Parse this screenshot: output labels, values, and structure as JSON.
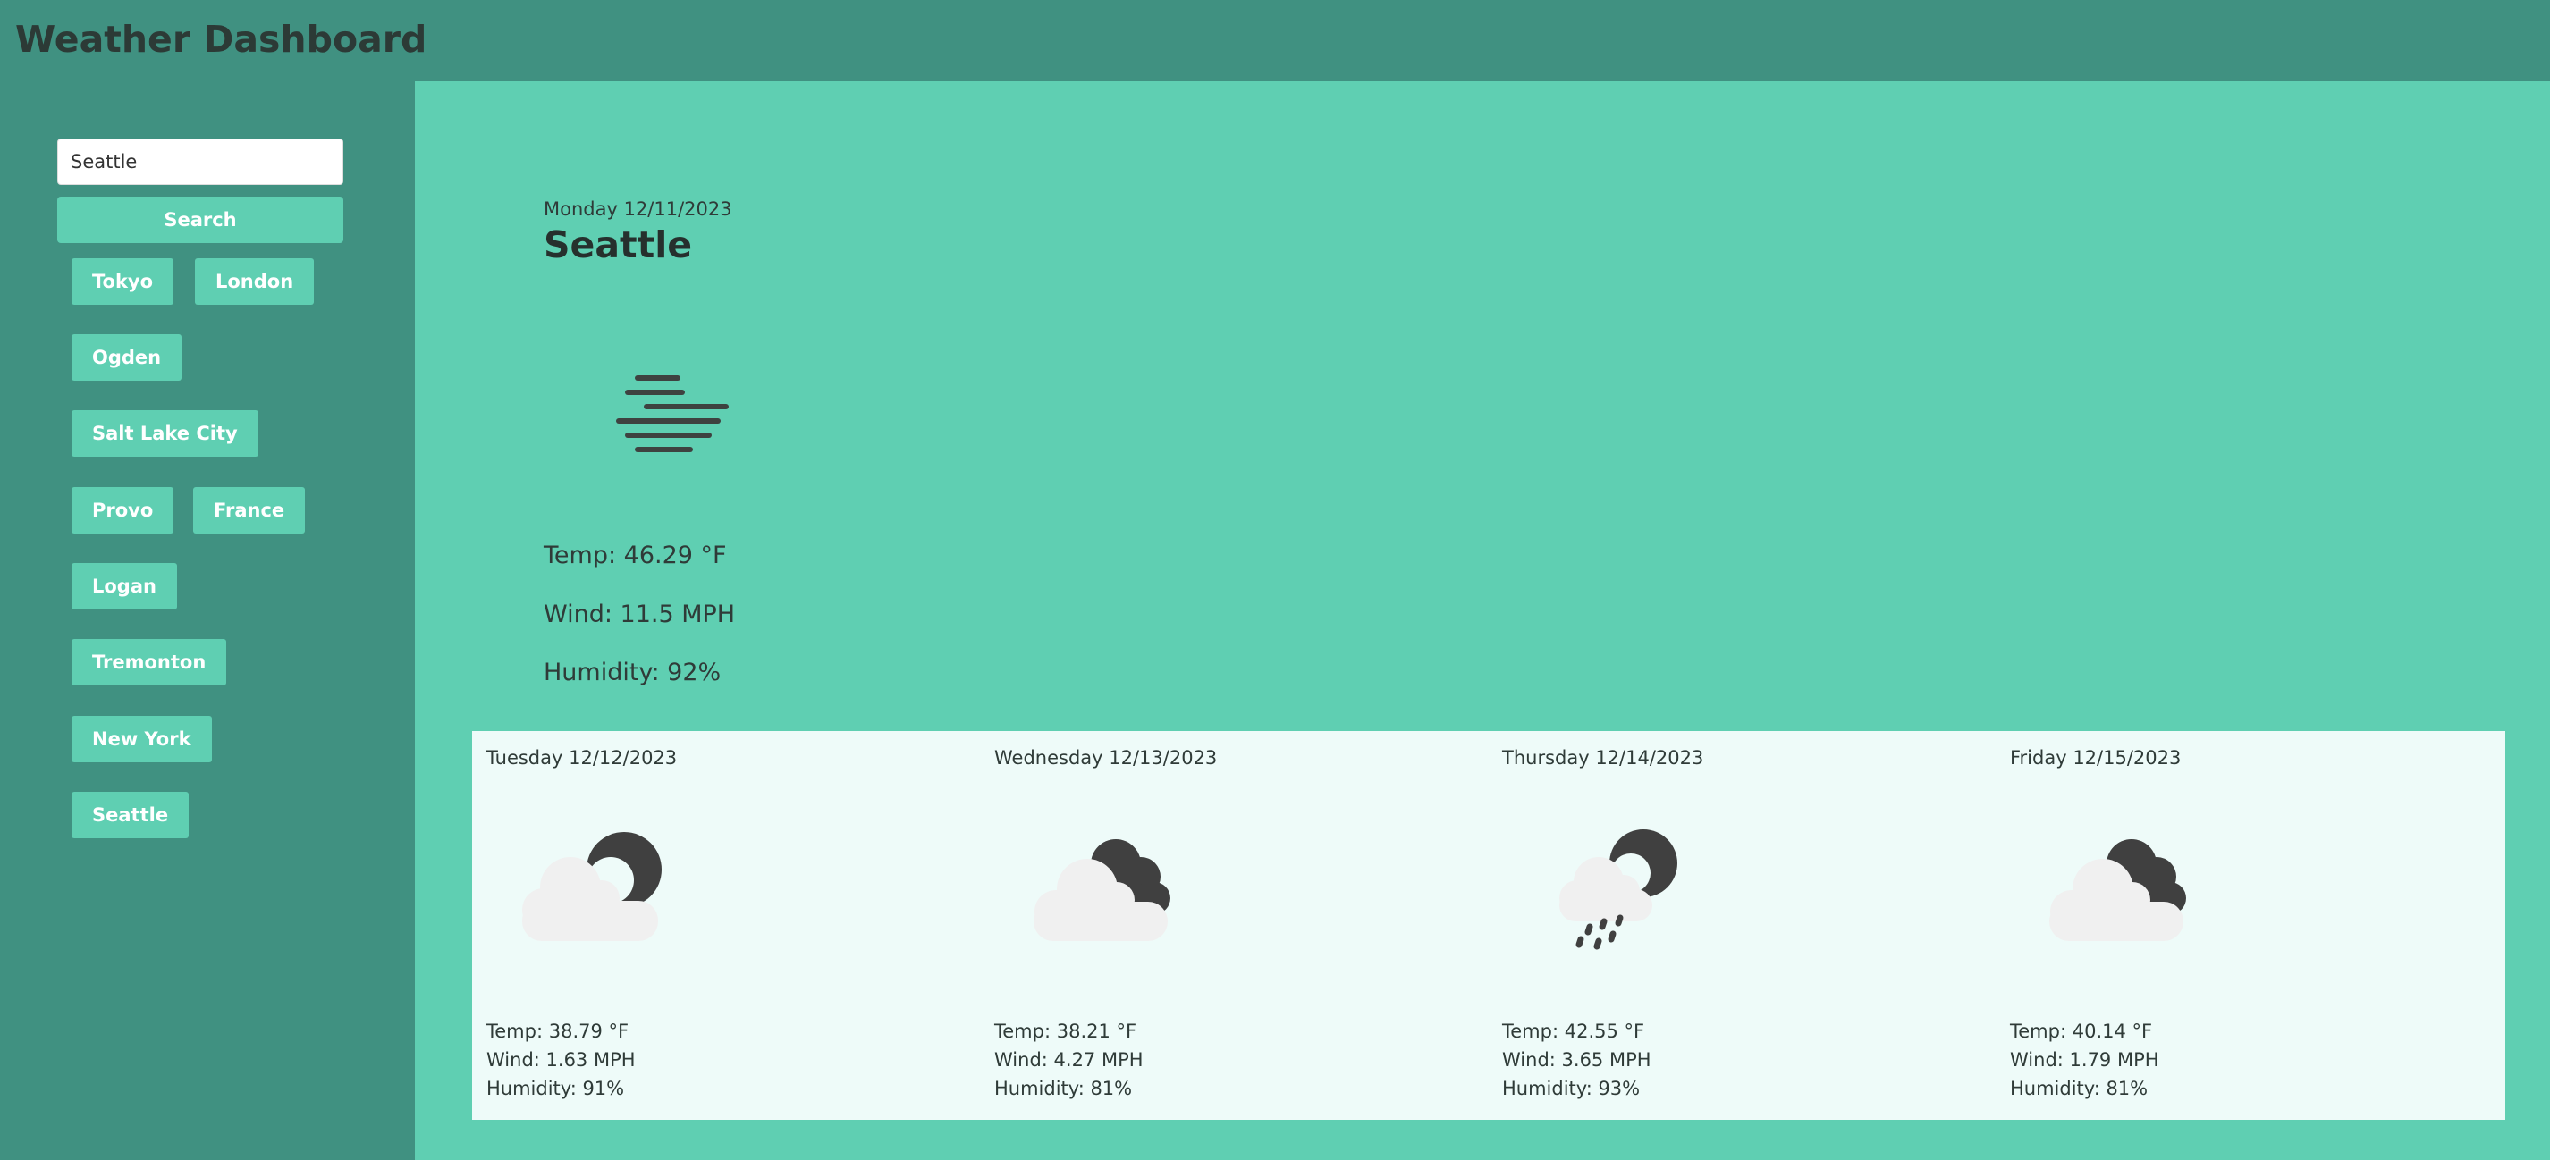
{
  "header": {
    "title": "Weather Dashboard"
  },
  "sidebar": {
    "search": {
      "value": "Seattle",
      "button_label": "Search"
    },
    "history": [
      "Tokyo",
      "London",
      "Ogden",
      "Salt Lake City",
      "Provo",
      "France",
      "Logan",
      "Tremonton",
      "New York",
      "Seattle"
    ]
  },
  "current": {
    "date": "Monday 12/11/2023",
    "city": "Seattle",
    "icon": "fog-icon",
    "temp": "Temp: 46.29 °F",
    "wind": "Wind: 11.5 MPH",
    "humidity": "Humidity: 92%"
  },
  "forecast": [
    {
      "date": "Tuesday 12/12/2023",
      "icon": "partly-cloudy-night-icon",
      "temp": "Temp: 38.79 °F",
      "wind": "Wind: 1.63 MPH",
      "humidity": "Humidity: 91%"
    },
    {
      "date": "Wednesday 12/13/2023",
      "icon": "cloudy-night-icon",
      "temp": "Temp: 38.21 °F",
      "wind": "Wind: 4.27 MPH",
      "humidity": "Humidity: 81%"
    },
    {
      "date": "Thursday 12/14/2023",
      "icon": "rain-night-icon",
      "temp": "Temp: 42.55 °F",
      "wind": "Wind: 3.65 MPH",
      "humidity": "Humidity: 93%"
    },
    {
      "date": "Friday 12/15/2023",
      "icon": "cloudy-night-icon",
      "temp": "Temp: 40.14 °F",
      "wind": "Wind: 1.79 MPH",
      "humidity": "Humidity: 81%"
    }
  ],
  "colors": {
    "header": "#409181",
    "main": "#5fcfb2",
    "forecast_bg": "#eefbf9",
    "accent_button": "#5fcfb2"
  }
}
